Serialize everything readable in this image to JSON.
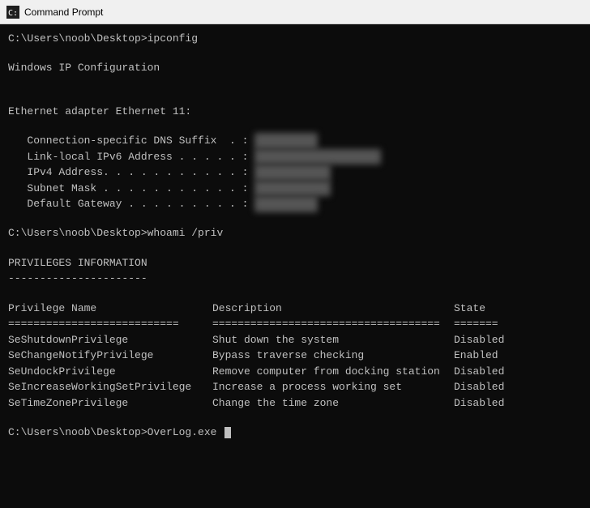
{
  "titleBar": {
    "icon": "cmd",
    "title": "Command Prompt"
  },
  "terminal": {
    "lines": [
      {
        "type": "prompt",
        "text": "C:\\Users\\noob\\Desktop>ipconfig"
      },
      {
        "type": "empty"
      },
      {
        "type": "normal",
        "text": "Windows IP Configuration"
      },
      {
        "type": "empty"
      },
      {
        "type": "empty"
      },
      {
        "type": "normal",
        "text": "Ethernet adapter Ethernet 11:"
      },
      {
        "type": "empty"
      },
      {
        "type": "normal",
        "text": "   Connection-specific DNS Suffix  . : ",
        "blurred": "██████████"
      },
      {
        "type": "normal",
        "text": "   Link-local IPv6 Address . . . . . : ",
        "blurred": "████████████████████"
      },
      {
        "type": "normal",
        "text": "   IPv4 Address. . . . . . . . . . . : ",
        "blurred": "████████████"
      },
      {
        "type": "normal",
        "text": "   Subnet Mask . . . . . . . . . . . : ",
        "blurred": "████████████"
      },
      {
        "type": "normal",
        "text": "   Default Gateway . . . . . . . . . : ",
        "blurred": "██████████"
      },
      {
        "type": "empty"
      },
      {
        "type": "prompt",
        "text": "C:\\Users\\noob\\Desktop>whoami /priv"
      },
      {
        "type": "empty"
      },
      {
        "type": "normal",
        "text": "PRIVILEGES INFORMATION"
      },
      {
        "type": "normal",
        "text": "----------------------"
      },
      {
        "type": "empty"
      },
      {
        "type": "header",
        "col1": "Privilege Name",
        "col2": "Description",
        "col3": "State"
      },
      {
        "type": "divider"
      },
      {
        "type": "priv",
        "col1": "SeShutdownPrivilege",
        "col2": "Shut down the system",
        "col3": "Disabled"
      },
      {
        "type": "priv",
        "col1": "SeChangeNotifyPrivilege",
        "col2": "Bypass traverse checking",
        "col3": "Enabled"
      },
      {
        "type": "priv",
        "col1": "SeUndockPrivilege",
        "col2": "Remove computer from docking station",
        "col3": "Disabled"
      },
      {
        "type": "priv",
        "col1": "SeIncreaseWorkingSetPrivilege",
        "col2": "Increase a process working set",
        "col3": "Disabled"
      },
      {
        "type": "priv",
        "col1": "SeTimeZonePrivilege",
        "col2": "Change the time zone",
        "col3": "Disabled"
      },
      {
        "type": "empty"
      },
      {
        "type": "prompt_cursor",
        "text": "C:\\Users\\noob\\Desktop>OverLog.exe"
      }
    ]
  }
}
